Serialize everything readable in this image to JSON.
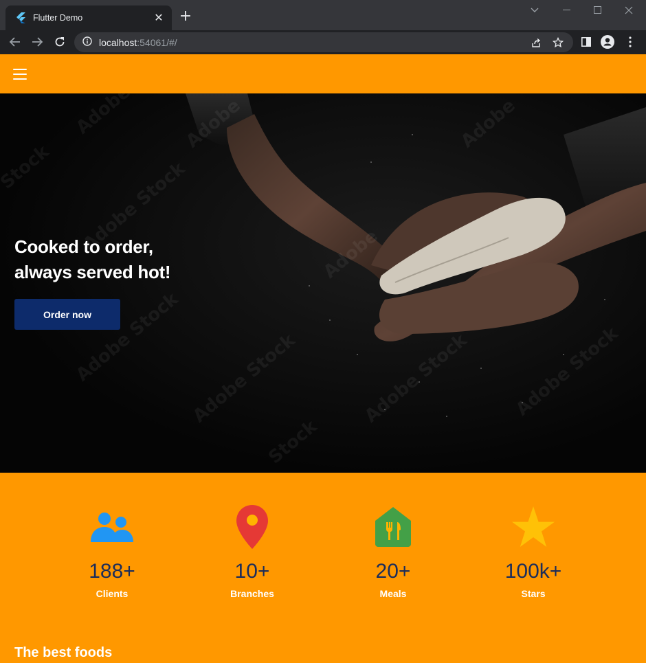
{
  "browser": {
    "tab_title": "Flutter Demo",
    "new_tab_icon": "plus-icon",
    "url_host": "localhost",
    "url_rest": ":54061/#/"
  },
  "app": {
    "accent_color": "#ff9800",
    "hero": {
      "title_line1": "Cooked to order,",
      "title_line2": "always served hot!",
      "button_label": "Order now",
      "button_color": "#0d2b6b"
    },
    "stats": [
      {
        "icon": "people-icon",
        "value": "188+",
        "label": "Clients",
        "color": "#2196f3"
      },
      {
        "icon": "location-pin-icon",
        "value": "10+",
        "label": "Branches",
        "color": "#e53935"
      },
      {
        "icon": "restaurant-icon",
        "value": "20+",
        "label": "Meals",
        "color": "#43a047"
      },
      {
        "icon": "star-icon",
        "value": "100k+",
        "label": "Stars",
        "color": "#ffc107"
      }
    ],
    "section_title": "The best foods"
  }
}
